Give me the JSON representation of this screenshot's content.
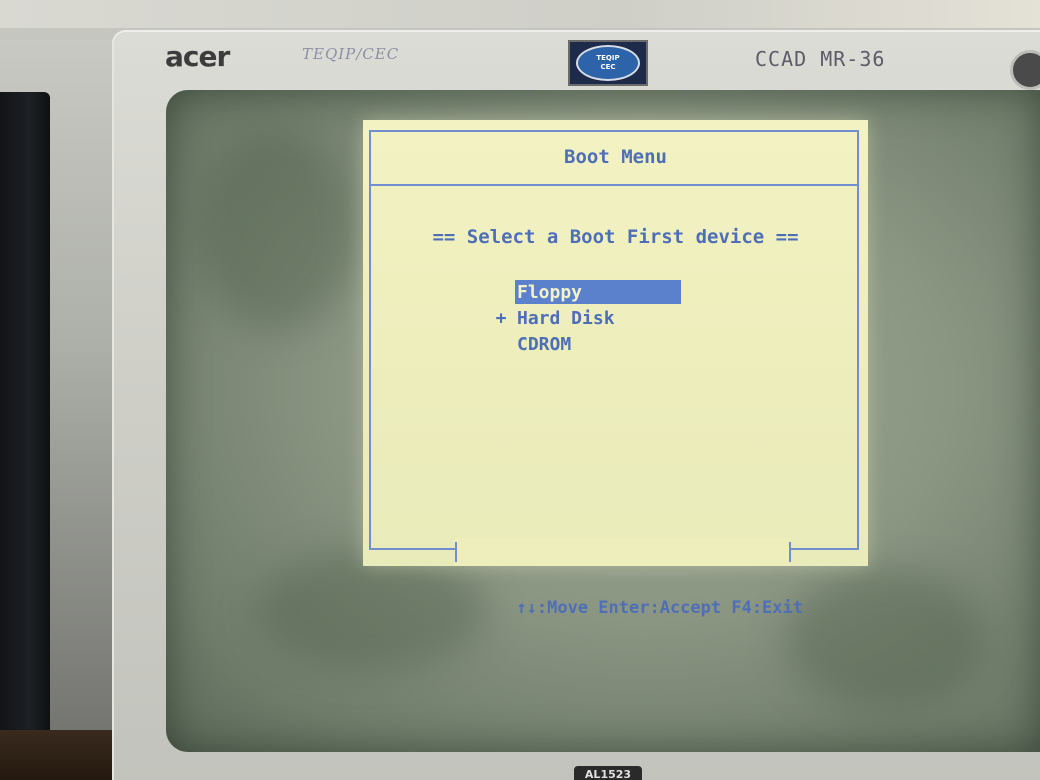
{
  "monitor": {
    "brand": "acer",
    "label_left": "TEQIP/CEC",
    "label_right": "CCAD MR-36",
    "sticker_top": "TEQIP",
    "sticker_bottom": "CEC",
    "model": "AL1523"
  },
  "boot_menu": {
    "title": "Boot Menu",
    "prompt": "== Select a Boot First device ==",
    "devices": [
      {
        "marker": "",
        "label": "Floppy",
        "selected": true
      },
      {
        "marker": "+",
        "label": "Hard Disk",
        "selected": false
      },
      {
        "marker": "",
        "label": "CDROM",
        "selected": false
      }
    ],
    "footer": "↑↓:Move Enter:Accept F4:Exit"
  },
  "colors": {
    "bios_background": "#eeeebb",
    "bios_text": "#4e6fb8",
    "selection": "#5b80cc"
  }
}
